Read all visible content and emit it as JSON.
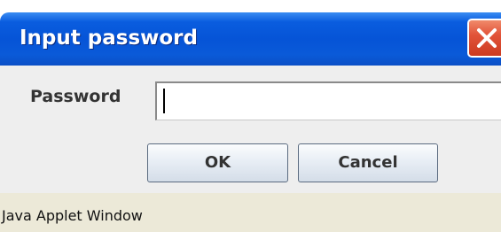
{
  "dialog": {
    "title": "Input password",
    "close_icon": "close-icon",
    "password_label": "Password",
    "password_value": "",
    "ok_label": "OK",
    "cancel_label": "Cancel"
  },
  "status": {
    "text": "Java Applet Window"
  },
  "colors": {
    "titlebar": "#0654d7",
    "close_button": "#e2543a",
    "dialog_background": "#eeeeee",
    "status_background": "#ece9d8"
  }
}
